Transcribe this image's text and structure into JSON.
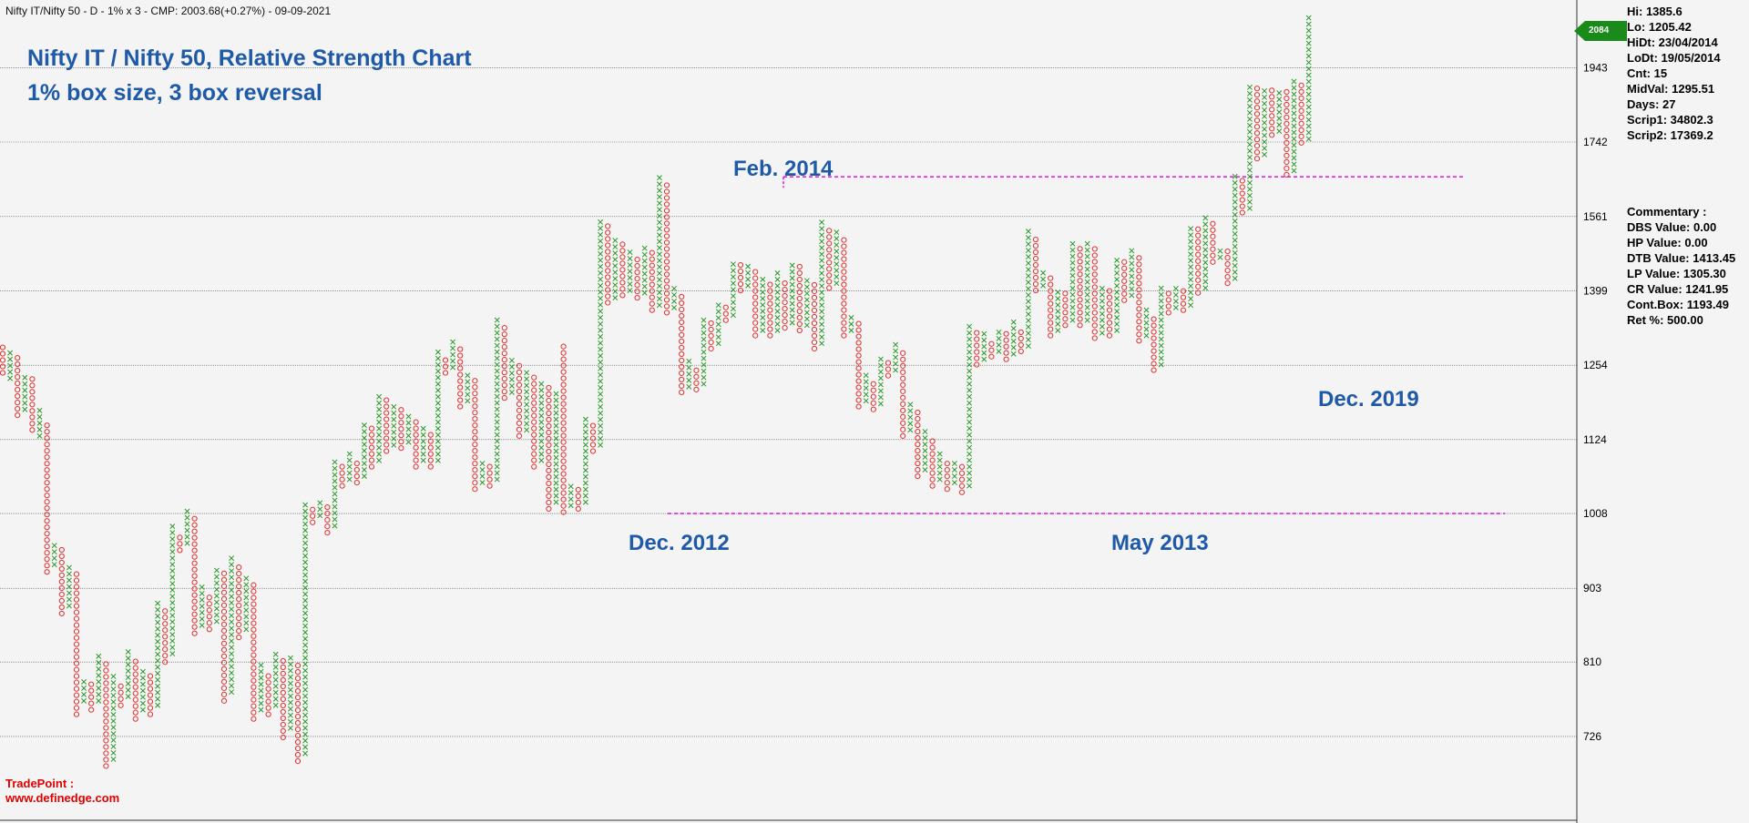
{
  "header": {
    "info": "Nifty IT/Nifty 50 - D - 1% x 3 - CMP: 2003.68(+0.27%) - 09-09-2021",
    "title": "Nifty IT / Nifty 50, Relative Strength Chart",
    "subtitle": "1% box size, 3 box reversal"
  },
  "colors": {
    "x": "#2a9a2a",
    "o": "#e03030",
    "grid": "#555555",
    "dash": "#e000e0",
    "accent": "#1f5aa8",
    "tag": "#1a8a1a"
  },
  "price_tag": "2084",
  "stats": [
    "Hi: 1385.6",
    "Lo: 1205.42",
    "HiDt: 23/04/2014",
    "LoDt: 19/05/2014",
    "Cnt: 15",
    "MidVal: 1295.51",
    "Days: 27",
    "Scrip1: 34802.3",
    "Scrip2: 17369.2"
  ],
  "commentary": [
    "Commentary :",
    "DBS Value:  0.00",
    "HP Value: 0.00",
    "DTB Value: 1413.45",
    "LP Value: 1305.30",
    "CR Value: 1241.95",
    "Cont.Box: 1193.49",
    "Ret %: 500.00"
  ],
  "annotations": {
    "feb2014": "Feb. 2014",
    "dec2012": "Dec. 2012",
    "may2013": "May 2013",
    "dec2019": "Dec. 2019"
  },
  "footer": {
    "line1": "TradePoint :",
    "line2": "www.definedge.com"
  },
  "chart_data": {
    "type": "point-and-figure",
    "title": "Nifty IT / Nifty 50, Relative Strength Chart",
    "subtitle": "1% box size, 3 box reversal",
    "y_scale": "log",
    "ylim": [
      660,
      2130
    ],
    "y_ticks": [
      726,
      810,
      903,
      1008,
      1124,
      1254,
      1399,
      1561,
      1742,
      1943
    ],
    "grid": true,
    "columns": [
      {
        "t": "O",
        "lo": 1240,
        "hi": 1290
      },
      {
        "t": "X",
        "lo": 1230,
        "hi": 1275
      },
      {
        "t": "O",
        "lo": 1165,
        "hi": 1270
      },
      {
        "t": "X",
        "lo": 1175,
        "hi": 1235
      },
      {
        "t": "O",
        "lo": 1140,
        "hi": 1225
      },
      {
        "t": "X",
        "lo": 1130,
        "hi": 1170
      },
      {
        "t": "O",
        "lo": 925,
        "hi": 1150
      },
      {
        "t": "X",
        "lo": 935,
        "hi": 965
      },
      {
        "t": "O",
        "lo": 870,
        "hi": 960
      },
      {
        "t": "X",
        "lo": 880,
        "hi": 935
      },
      {
        "t": "O",
        "lo": 750,
        "hi": 925
      },
      {
        "t": "X",
        "lo": 765,
        "hi": 790
      },
      {
        "t": "O",
        "lo": 755,
        "hi": 785
      },
      {
        "t": "X",
        "lo": 765,
        "hi": 820
      },
      {
        "t": "O",
        "lo": 695,
        "hi": 810
      },
      {
        "t": "X",
        "lo": 702,
        "hi": 790
      },
      {
        "t": "O",
        "lo": 760,
        "hi": 785
      },
      {
        "t": "X",
        "lo": 770,
        "hi": 820
      },
      {
        "t": "O",
        "lo": 745,
        "hi": 810
      },
      {
        "t": "X",
        "lo": 755,
        "hi": 795
      },
      {
        "t": "O",
        "lo": 750,
        "hi": 795
      },
      {
        "t": "X",
        "lo": 760,
        "hi": 885
      },
      {
        "t": "O",
        "lo": 810,
        "hi": 870
      },
      {
        "t": "X",
        "lo": 820,
        "hi": 985
      },
      {
        "t": "O",
        "lo": 955,
        "hi": 975
      },
      {
        "t": "X",
        "lo": 965,
        "hi": 1015
      },
      {
        "t": "O",
        "lo": 845,
        "hi": 1005
      },
      {
        "t": "X",
        "lo": 855,
        "hi": 905
      },
      {
        "t": "O",
        "lo": 850,
        "hi": 895
      },
      {
        "t": "X",
        "lo": 860,
        "hi": 930
      },
      {
        "t": "O",
        "lo": 765,
        "hi": 920
      },
      {
        "t": "X",
        "lo": 775,
        "hi": 945
      },
      {
        "t": "O",
        "lo": 840,
        "hi": 935
      },
      {
        "t": "X",
        "lo": 850,
        "hi": 915
      },
      {
        "t": "O",
        "lo": 745,
        "hi": 905
      },
      {
        "t": "X",
        "lo": 755,
        "hi": 805
      },
      {
        "t": "O",
        "lo": 750,
        "hi": 795
      },
      {
        "t": "X",
        "lo": 760,
        "hi": 820
      },
      {
        "t": "O",
        "lo": 725,
        "hi": 810
      },
      {
        "t": "X",
        "lo": 735,
        "hi": 815
      },
      {
        "t": "O",
        "lo": 700,
        "hi": 805
      },
      {
        "t": "X",
        "lo": 708,
        "hi": 1020
      },
      {
        "t": "O",
        "lo": 995,
        "hi": 1010
      },
      {
        "t": "X",
        "lo": 1005,
        "hi": 1025
      },
      {
        "t": "O",
        "lo": 980,
        "hi": 1015
      },
      {
        "t": "X",
        "lo": 990,
        "hi": 1085
      },
      {
        "t": "O",
        "lo": 1050,
        "hi": 1075
      },
      {
        "t": "X",
        "lo": 1060,
        "hi": 1100
      },
      {
        "t": "O",
        "lo": 1055,
        "hi": 1090
      },
      {
        "t": "X",
        "lo": 1065,
        "hi": 1150
      },
      {
        "t": "O",
        "lo": 1080,
        "hi": 1140
      },
      {
        "t": "X",
        "lo": 1090,
        "hi": 1200
      },
      {
        "t": "O",
        "lo": 1105,
        "hi": 1190
      },
      {
        "t": "X",
        "lo": 1115,
        "hi": 1185
      },
      {
        "t": "O",
        "lo": 1110,
        "hi": 1175
      },
      {
        "t": "X",
        "lo": 1120,
        "hi": 1160
      },
      {
        "t": "O",
        "lo": 1080,
        "hi": 1150
      },
      {
        "t": "X",
        "lo": 1090,
        "hi": 1140
      },
      {
        "t": "O",
        "lo": 1080,
        "hi": 1130
      },
      {
        "t": "X",
        "lo": 1090,
        "hi": 1275
      },
      {
        "t": "O",
        "lo": 1240,
        "hi": 1265
      },
      {
        "t": "X",
        "lo": 1250,
        "hi": 1300
      },
      {
        "t": "O",
        "lo": 1180,
        "hi": 1290
      },
      {
        "t": "X",
        "lo": 1190,
        "hi": 1235
      },
      {
        "t": "O",
        "lo": 1045,
        "hi": 1225
      },
      {
        "t": "X",
        "lo": 1055,
        "hi": 1085
      },
      {
        "t": "O",
        "lo": 1050,
        "hi": 1075
      },
      {
        "t": "X",
        "lo": 1060,
        "hi": 1335
      },
      {
        "t": "O",
        "lo": 1195,
        "hi": 1325
      },
      {
        "t": "X",
        "lo": 1205,
        "hi": 1265
      },
      {
        "t": "O",
        "lo": 1130,
        "hi": 1255
      },
      {
        "t": "X",
        "lo": 1140,
        "hi": 1245
      },
      {
        "t": "O",
        "lo": 1080,
        "hi": 1235
      },
      {
        "t": "X",
        "lo": 1090,
        "hi": 1225
      },
      {
        "t": "O",
        "lo": 1015,
        "hi": 1215
      },
      {
        "t": "X",
        "lo": 1025,
        "hi": 1200
      },
      {
        "t": "O",
        "lo": 1010,
        "hi": 1290
      },
      {
        "t": "X",
        "lo": 1020,
        "hi": 1050
      },
      {
        "t": "O",
        "lo": 1015,
        "hi": 1040
      },
      {
        "t": "X",
        "lo": 1025,
        "hi": 1160
      },
      {
        "t": "O",
        "lo": 1105,
        "hi": 1150
      },
      {
        "t": "X",
        "lo": 1115,
        "hi": 1555
      },
      {
        "t": "O",
        "lo": 1375,
        "hi": 1545
      },
      {
        "t": "X",
        "lo": 1385,
        "hi": 1505
      },
      {
        "t": "O",
        "lo": 1390,
        "hi": 1495
      },
      {
        "t": "X",
        "lo": 1400,
        "hi": 1480
      },
      {
        "t": "O",
        "lo": 1385,
        "hi": 1470
      },
      {
        "t": "X",
        "lo": 1395,
        "hi": 1485
      },
      {
        "t": "O",
        "lo": 1360,
        "hi": 1475
      },
      {
        "t": "X",
        "lo": 1370,
        "hi": 1655
      },
      {
        "t": "O",
        "lo": 1355,
        "hi": 1640
      },
      {
        "t": "X",
        "lo": 1365,
        "hi": 1400
      },
      {
        "t": "O",
        "lo": 1205,
        "hi": 1390
      },
      {
        "t": "X",
        "lo": 1215,
        "hi": 1260
      },
      {
        "t": "O",
        "lo": 1210,
        "hi": 1250
      },
      {
        "t": "X",
        "lo": 1220,
        "hi": 1345
      },
      {
        "t": "O",
        "lo": 1285,
        "hi": 1335
      },
      {
        "t": "X",
        "lo": 1295,
        "hi": 1375
      },
      {
        "t": "O",
        "lo": 1340,
        "hi": 1365
      },
      {
        "t": "X",
        "lo": 1350,
        "hi": 1460
      },
      {
        "t": "O",
        "lo": 1400,
        "hi": 1450
      },
      {
        "t": "X",
        "lo": 1410,
        "hi": 1455
      },
      {
        "t": "O",
        "lo": 1310,
        "hi": 1445
      },
      {
        "t": "X",
        "lo": 1320,
        "hi": 1425
      },
      {
        "t": "O",
        "lo": 1310,
        "hi": 1415
      },
      {
        "t": "X",
        "lo": 1320,
        "hi": 1430
      },
      {
        "t": "O",
        "lo": 1325,
        "hi": 1420
      },
      {
        "t": "X",
        "lo": 1335,
        "hi": 1455
      },
      {
        "t": "O",
        "lo": 1320,
        "hi": 1445
      },
      {
        "t": "X",
        "lo": 1330,
        "hi": 1420
      },
      {
        "t": "O",
        "lo": 1285,
        "hi": 1410
      },
      {
        "t": "X",
        "lo": 1295,
        "hi": 1545
      },
      {
        "t": "O",
        "lo": 1405,
        "hi": 1535
      },
      {
        "t": "X",
        "lo": 1415,
        "hi": 1525
      },
      {
        "t": "O",
        "lo": 1310,
        "hi": 1515
      },
      {
        "t": "X",
        "lo": 1320,
        "hi": 1340
      },
      {
        "t": "O",
        "lo": 1180,
        "hi": 1330
      },
      {
        "t": "X",
        "lo": 1190,
        "hi": 1230
      },
      {
        "t": "O",
        "lo": 1175,
        "hi": 1220
      },
      {
        "t": "X",
        "lo": 1185,
        "hi": 1270
      },
      {
        "t": "O",
        "lo": 1235,
        "hi": 1260
      },
      {
        "t": "X",
        "lo": 1245,
        "hi": 1290
      },
      {
        "t": "O",
        "lo": 1130,
        "hi": 1280
      },
      {
        "t": "X",
        "lo": 1140,
        "hi": 1180
      },
      {
        "t": "O",
        "lo": 1065,
        "hi": 1170
      },
      {
        "t": "X",
        "lo": 1075,
        "hi": 1135
      },
      {
        "t": "O",
        "lo": 1050,
        "hi": 1125
      },
      {
        "t": "X",
        "lo": 1060,
        "hi": 1100
      },
      {
        "t": "O",
        "lo": 1045,
        "hi": 1090
      },
      {
        "t": "X",
        "lo": 1055,
        "hi": 1085
      },
      {
        "t": "O",
        "lo": 1040,
        "hi": 1075
      },
      {
        "t": "X",
        "lo": 1050,
        "hi": 1325
      },
      {
        "t": "O",
        "lo": 1255,
        "hi": 1315
      },
      {
        "t": "X",
        "lo": 1265,
        "hi": 1310
      },
      {
        "t": "O",
        "lo": 1270,
        "hi": 1300
      },
      {
        "t": "X",
        "lo": 1280,
        "hi": 1320
      },
      {
        "t": "O",
        "lo": 1265,
        "hi": 1310
      },
      {
        "t": "X",
        "lo": 1275,
        "hi": 1330
      },
      {
        "t": "O",
        "lo": 1280,
        "hi": 1320
      },
      {
        "t": "X",
        "lo": 1290,
        "hi": 1525
      },
      {
        "t": "O",
        "lo": 1400,
        "hi": 1515
      },
      {
        "t": "X",
        "lo": 1410,
        "hi": 1440
      },
      {
        "t": "O",
        "lo": 1310,
        "hi": 1430
      },
      {
        "t": "X",
        "lo": 1320,
        "hi": 1400
      },
      {
        "t": "O",
        "lo": 1330,
        "hi": 1390
      },
      {
        "t": "X",
        "lo": 1340,
        "hi": 1505
      },
      {
        "t": "O",
        "lo": 1330,
        "hi": 1495
      },
      {
        "t": "X",
        "lo": 1340,
        "hi": 1505
      },
      {
        "t": "O",
        "lo": 1305,
        "hi": 1495
      },
      {
        "t": "X",
        "lo": 1315,
        "hi": 1410
      },
      {
        "t": "O",
        "lo": 1310,
        "hi": 1400
      },
      {
        "t": "X",
        "lo": 1320,
        "hi": 1470
      },
      {
        "t": "O",
        "lo": 1380,
        "hi": 1460
      },
      {
        "t": "X",
        "lo": 1390,
        "hi": 1480
      },
      {
        "t": "O",
        "lo": 1300,
        "hi": 1470
      },
      {
        "t": "X",
        "lo": 1310,
        "hi": 1355
      },
      {
        "t": "O",
        "lo": 1245,
        "hi": 1345
      },
      {
        "t": "X",
        "lo": 1255,
        "hi": 1400
      },
      {
        "t": "O",
        "lo": 1355,
        "hi": 1390
      },
      {
        "t": "X",
        "lo": 1365,
        "hi": 1410
      },
      {
        "t": "O",
        "lo": 1360,
        "hi": 1400
      },
      {
        "t": "X",
        "lo": 1370,
        "hi": 1540
      },
      {
        "t": "O",
        "lo": 1395,
        "hi": 1530
      },
      {
        "t": "X",
        "lo": 1405,
        "hi": 1555
      },
      {
        "t": "O",
        "lo": 1460,
        "hi": 1545
      },
      {
        "t": "X",
        "lo": 1470,
        "hi": 1490
      },
      {
        "t": "O",
        "lo": 1415,
        "hi": 1480
      },
      {
        "t": "X",
        "lo": 1425,
        "hi": 1660
      },
      {
        "t": "O",
        "lo": 1570,
        "hi": 1650
      },
      {
        "t": "X",
        "lo": 1580,
        "hi": 1895
      },
      {
        "t": "O",
        "lo": 1700,
        "hi": 1885
      },
      {
        "t": "X",
        "lo": 1710,
        "hi": 1885
      },
      {
        "t": "O",
        "lo": 1760,
        "hi": 1875
      },
      {
        "t": "X",
        "lo": 1770,
        "hi": 1880
      },
      {
        "t": "O",
        "lo": 1660,
        "hi": 1870
      },
      {
        "t": "X",
        "lo": 1670,
        "hi": 1900
      },
      {
        "t": "O",
        "lo": 1740,
        "hi": 1890
      },
      {
        "t": "X",
        "lo": 1750,
        "hi": 2084
      }
    ],
    "support_line": 1008,
    "resistance_line": 1655
  }
}
